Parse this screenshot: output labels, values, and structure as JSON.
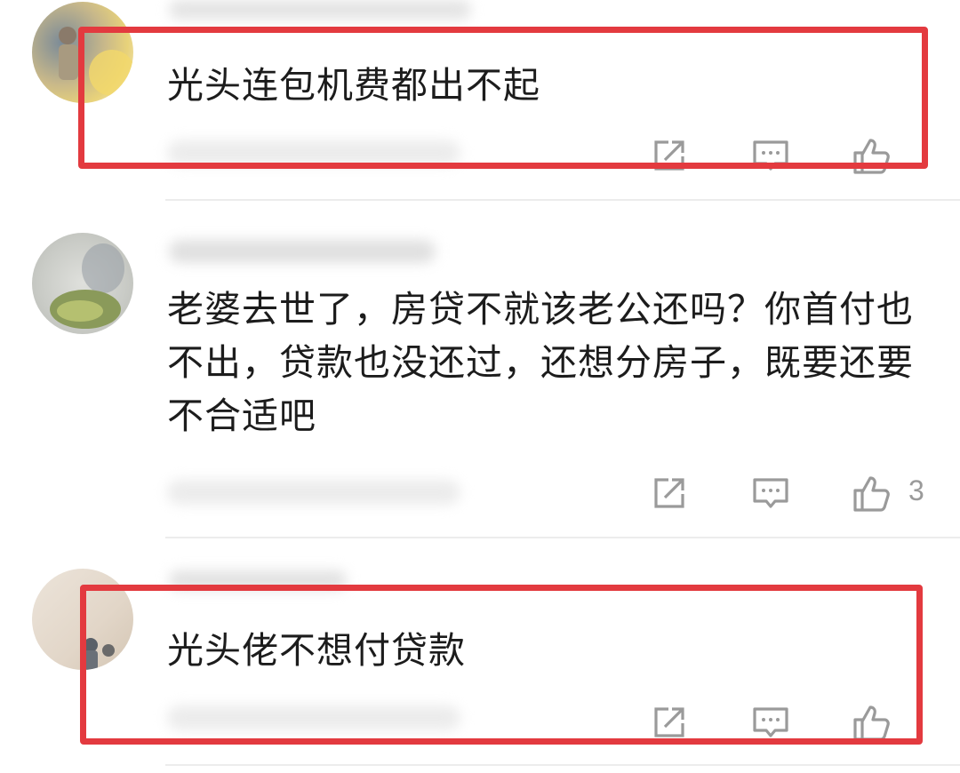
{
  "comments": [
    {
      "text": "光头连包机费都出不起",
      "avatar_icon": "user-avatar-icon",
      "like_count": "",
      "highlighted": true
    },
    {
      "text": "老婆去世了，房贷不就该老公还吗？你首付也不出，贷款也没还过，还想分房子，既要还要不合适吧",
      "avatar_icon": "user-avatar-icon",
      "like_count": "3",
      "highlighted": false
    },
    {
      "text": "光头佬不想付贷款",
      "avatar_icon": "user-avatar-icon",
      "like_count": "",
      "highlighted": true
    }
  ],
  "icons": {
    "share": "share-icon",
    "reply": "reply-comment-icon",
    "like": "thumbs-up-icon"
  },
  "colors": {
    "highlight": "#e33a3f",
    "text": "#1c1c1c",
    "icon": "#9a9a9a"
  }
}
